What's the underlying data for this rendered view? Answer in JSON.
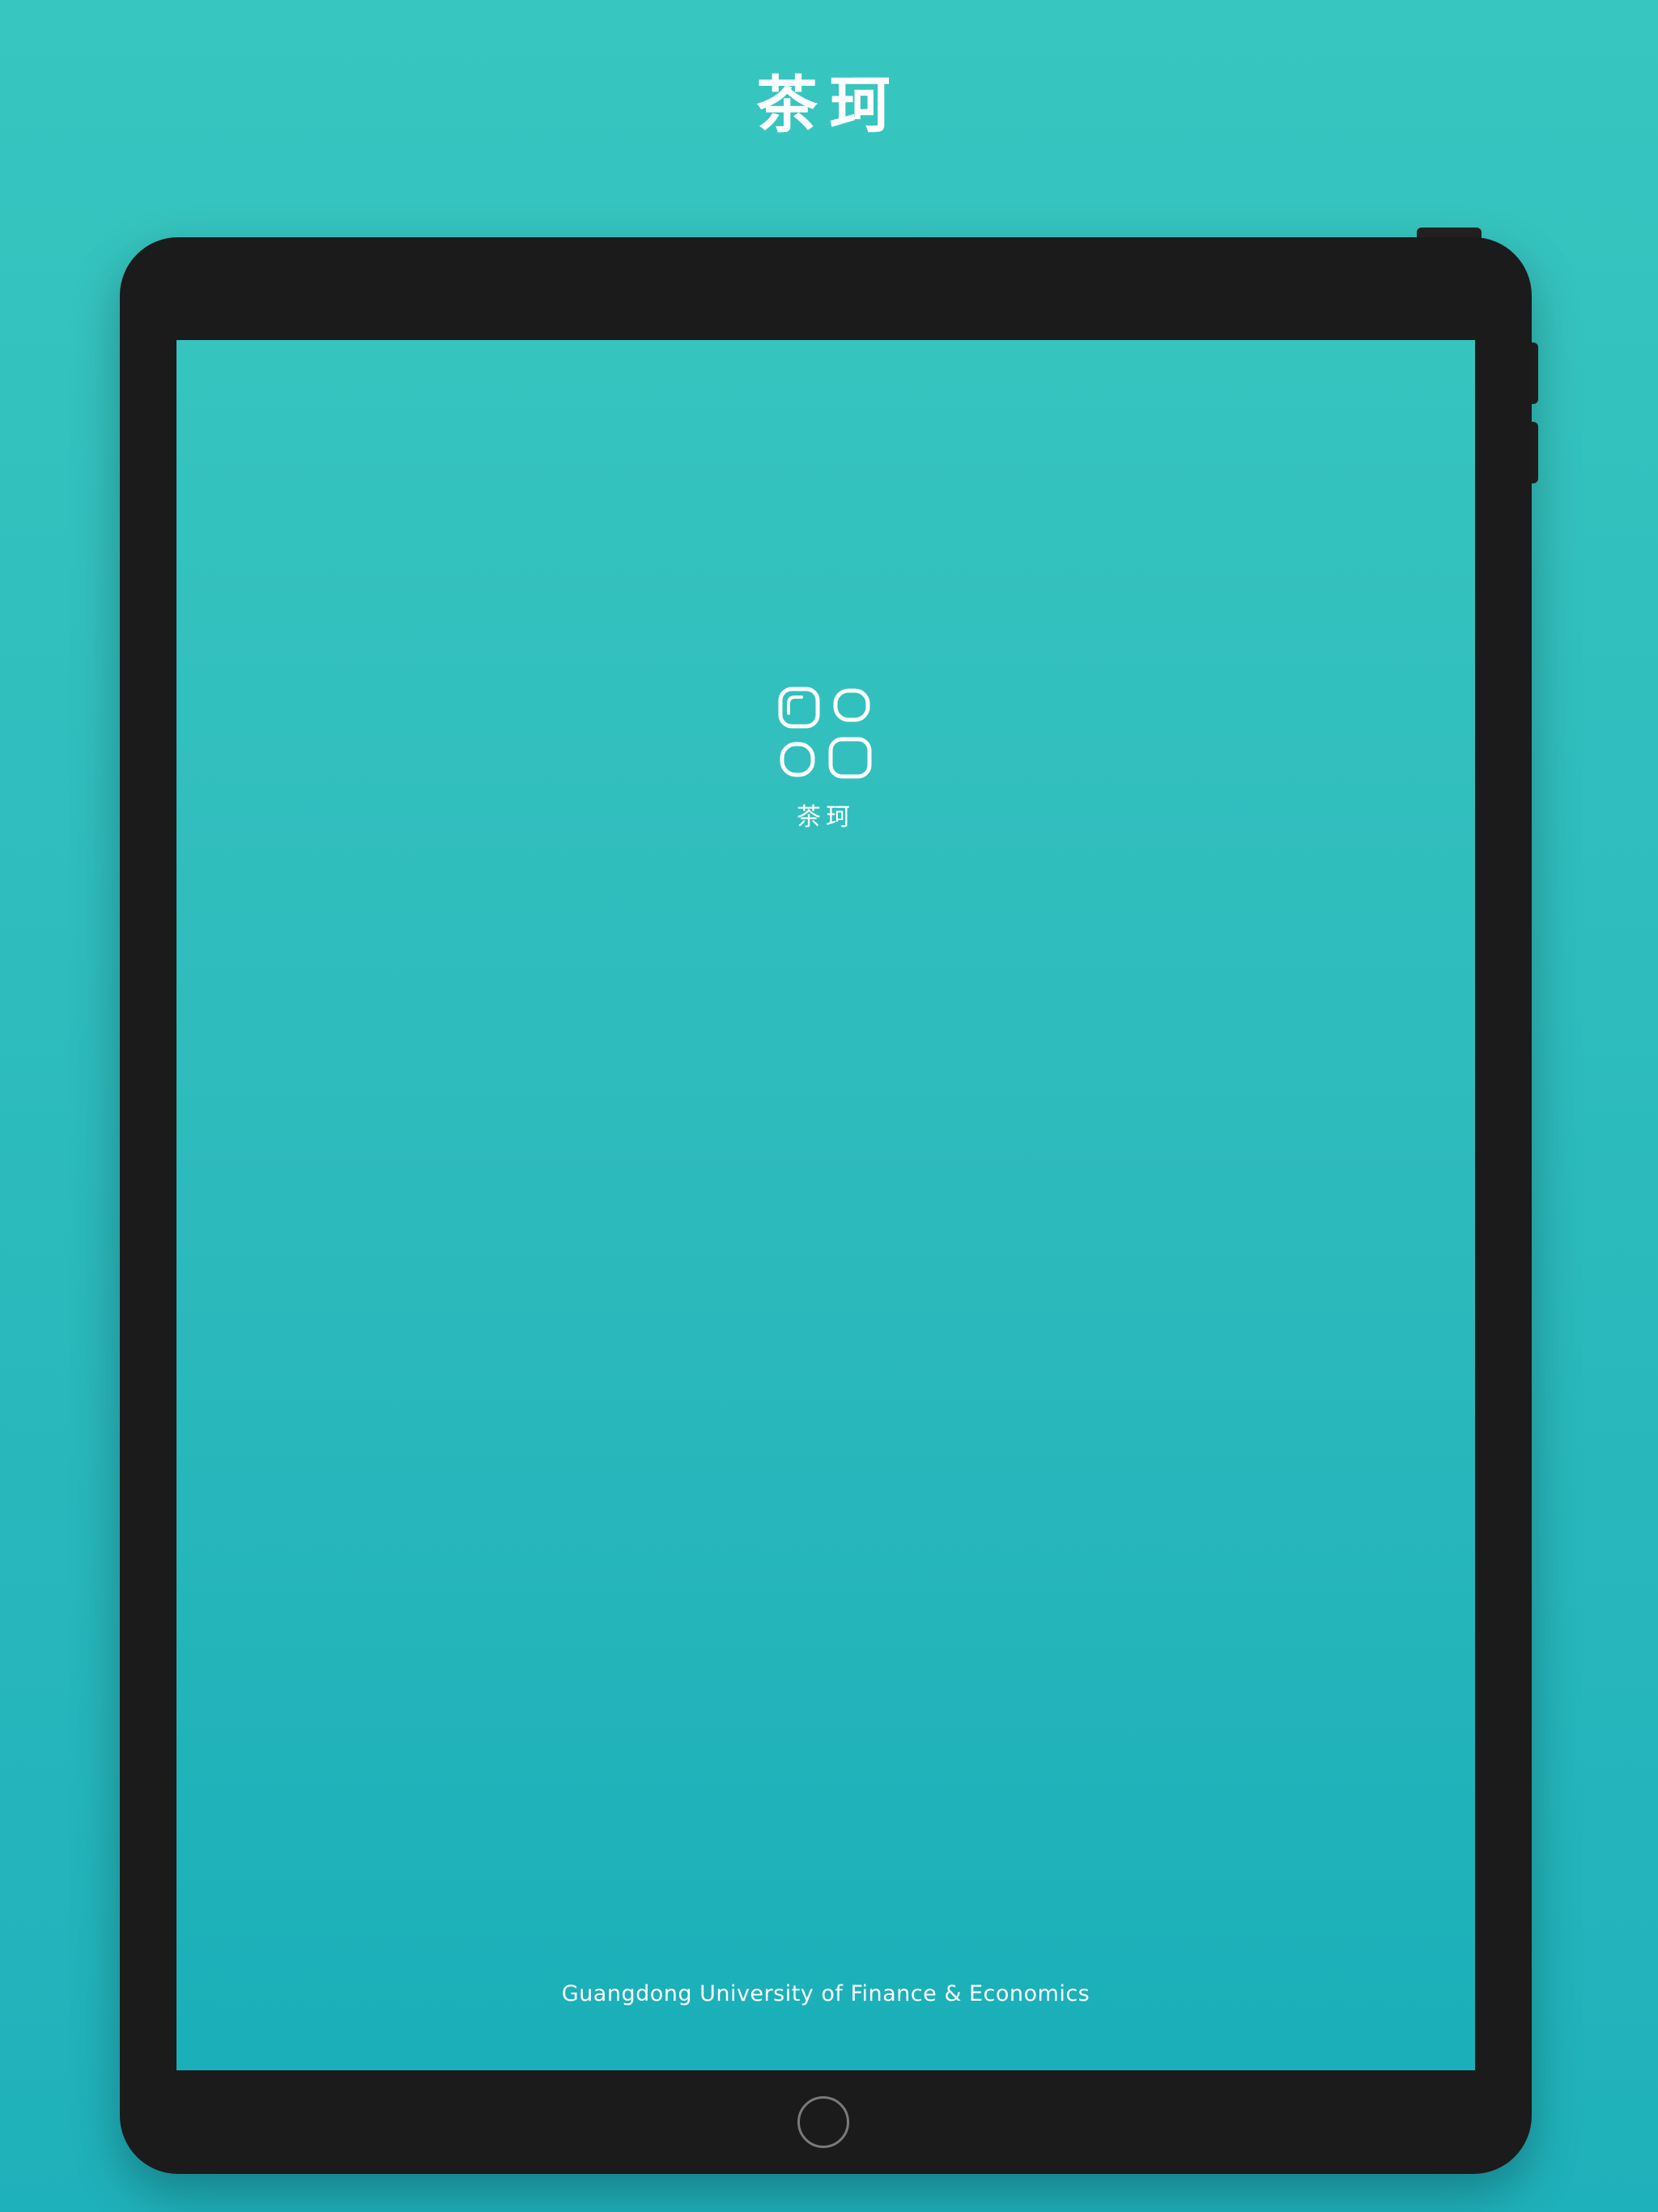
{
  "header": {
    "title": "茶珂"
  },
  "app": {
    "logo_icon": "app-grid-logo-icon",
    "logo_label": "茶珂",
    "footer": "Guangdong University of Finance & Economics"
  },
  "colors": {
    "background": "#38c6c0",
    "background_bottom": "#1fb1bb",
    "device_frame": "#1b1b1b",
    "text": "#ffffff"
  }
}
